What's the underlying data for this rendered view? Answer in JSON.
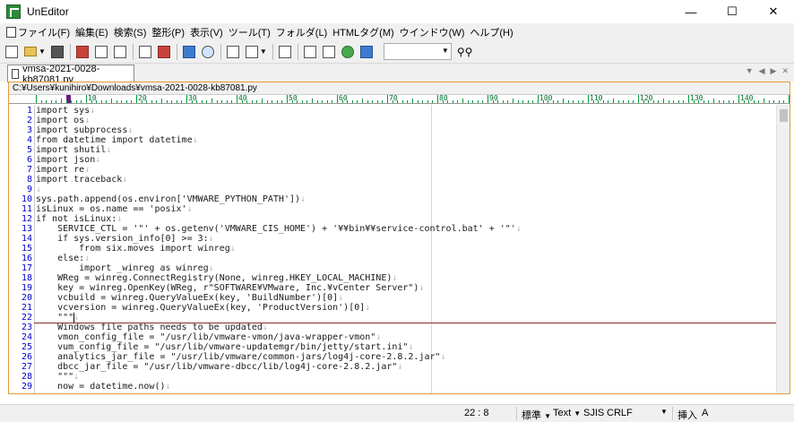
{
  "window": {
    "title": "UnEditor",
    "minimize": "—",
    "maximize": "☐",
    "close": "✕"
  },
  "menu": [
    "ファイル(F)",
    "編集(E)",
    "検索(S)",
    "整形(P)",
    "表示(V)",
    "ツール(T)",
    "フォルダ(L)",
    "HTMLタグ(M)",
    "ウインドウ(W)",
    "ヘルプ(H)"
  ],
  "toolbar": {
    "icons": [
      "new-file-icon",
      "open-folder-icon",
      "save-icon",
      "save-all-icon",
      "print-icon",
      "print-preview-icon",
      "lock-icon",
      "bookmark-icon",
      "window-icon",
      "find-icon",
      "spell-icon",
      "graph-icon",
      "copy-icon",
      "grid-icon",
      "page-icon",
      "browser-icon",
      "search-web-icon"
    ],
    "combo_value": ""
  },
  "tab": {
    "label": "vmsa-2021-0028-kb87081.py"
  },
  "path": "C:¥Users¥kunihiro¥Downloads¥vmsa-2021-0028-kb87081.py",
  "ruler": [
    "10",
    "20",
    "30",
    "40",
    "50",
    "60",
    "70",
    "80",
    "90",
    "100",
    "110",
    "120",
    "130",
    "140"
  ],
  "eol_mark": "↓",
  "code": [
    "import sys",
    "import os",
    "import subprocess",
    "from datetime import datetime",
    "import shutil",
    "import json",
    "import re",
    "import traceback",
    "",
    "sys.path.append(os.environ['VMWARE_PYTHON_PATH'])",
    "isLinux = os.name == 'posix'",
    "if not isLinux:",
    "    SERVICE_CTL = '\"' + os.getenv('VMWARE_CIS_HOME') + '¥¥bin¥¥service-control.bat' + '\"'",
    "    if sys.version_info[0] >= 3:",
    "        from six.moves import winreg",
    "    else:",
    "        import _winreg as winreg",
    "    WReg = winreg.ConnectRegistry(None, winreg.HKEY_LOCAL_MACHINE)",
    "    key = winreg.OpenKey(WReg, r\"SOFTWARE¥VMware, Inc.¥vCenter Server\")",
    "    vcbuild = winreg.QueryValueEx(key, 'BuildNumber')[0]",
    "    vcversion = winreg.QueryValueEx(key, 'ProductVersion')[0]",
    "    \"\"\"",
    "    Windows file paths needs to be updated",
    "    vmon_config_file = \"/usr/lib/vmware-vmon/java-wrapper-vmon\"",
    "    vum_config_file = \"/usr/lib/vmware-updatemgr/bin/jetty/start.ini\"",
    "    analytics_jar_file = \"/usr/lib/vmware/common-jars/log4j-core-2.8.2.jar\"",
    "    dbcc_jar_file = \"/usr/lib/vmware-dbcc/lib/log4j-core-2.8.2.jar\"",
    "    \"\"\"",
    "    now = datetime.now()"
  ],
  "cursor": {
    "line": 22,
    "col": 8
  },
  "status": {
    "position": "22 : 8",
    "mode": "標準",
    "type": "Text",
    "encoding": "SJIS",
    "newline": "CRLF",
    "insert": "挿入",
    "ime": "A"
  }
}
